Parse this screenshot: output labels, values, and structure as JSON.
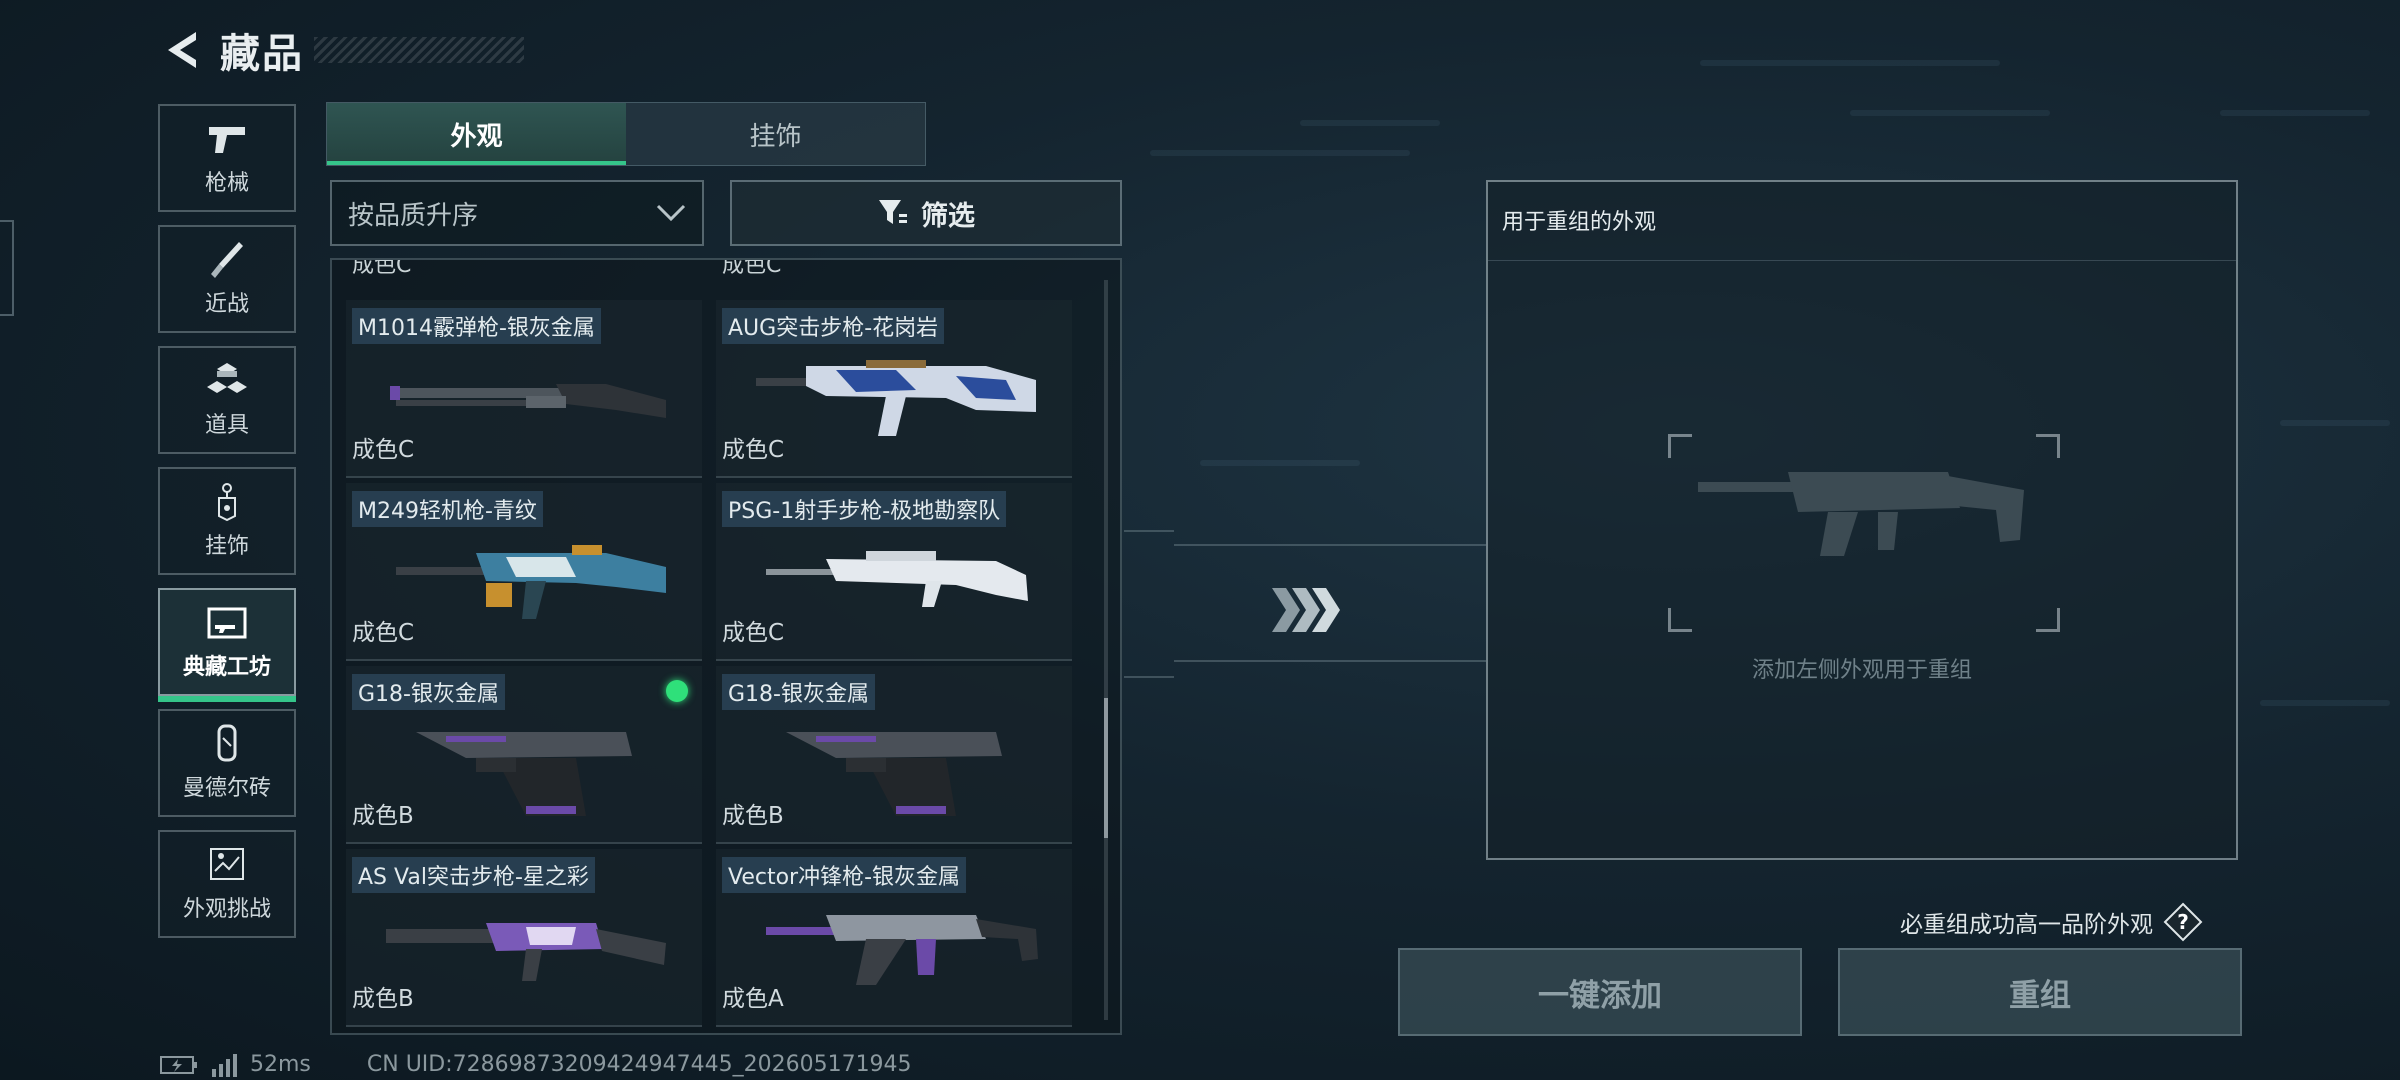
{
  "header": {
    "title": "藏品",
    "back_icon": "back-arrow-icon"
  },
  "sidebar": {
    "items": [
      {
        "label": "枪械",
        "icon": "pistol-icon",
        "active": false
      },
      {
        "label": "近战",
        "icon": "knife-icon",
        "active": false
      },
      {
        "label": "道具",
        "icon": "cubes-icon",
        "active": false
      },
      {
        "label": "挂饰",
        "icon": "pendant-icon",
        "active": false
      },
      {
        "label": "典藏工坊",
        "icon": "workshop-icon",
        "active": true
      },
      {
        "label": "曼德尔砖",
        "icon": "brick-icon",
        "active": false
      },
      {
        "label": "外观挑战",
        "icon": "challenge-icon",
        "active": false
      }
    ]
  },
  "tabs": [
    {
      "label": "外观",
      "active": true
    },
    {
      "label": "挂饰",
      "active": false
    }
  ],
  "sort": {
    "selected": "按品质升序"
  },
  "filter": {
    "label": "筛选",
    "icon": "funnel-icon"
  },
  "grid": {
    "partial_top": [
      "成色C",
      "成色C"
    ],
    "items": [
      {
        "name": "M1014霰弹枪-银灰金属",
        "grade": "成色C",
        "selected": false
      },
      {
        "name": "AUG突击步枪-花岗岩",
        "grade": "成色C",
        "selected": false
      },
      {
        "name": "M249轻机枪-青纹",
        "grade": "成色C",
        "selected": false
      },
      {
        "name": "PSG-1射手步枪-极地勘察队",
        "grade": "成色C",
        "selected": false
      },
      {
        "name": "G18-银灰金属",
        "grade": "成色B",
        "selected": true
      },
      {
        "name": "G18-银灰金属",
        "grade": "成色B",
        "selected": false
      },
      {
        "name": "AS Val突击步枪-星之彩",
        "grade": "成色B",
        "selected": false
      },
      {
        "name": "Vector冲锋枪-银灰金属",
        "grade": "成色A",
        "selected": false
      }
    ]
  },
  "recompose": {
    "title": "用于重组的外观",
    "placeholder": "添加左侧外观用于重组",
    "hint": "必重组成功高一品阶外观",
    "help_icon": "question-icon",
    "add_all_label": "一键添加",
    "recompose_label": "重组"
  },
  "status": {
    "ping": "52ms",
    "uid": "CN UID:7286987320942494744​5_202605171945"
  },
  "colors": {
    "accent": "#35c58a",
    "selected_dot": "#2fe07a"
  }
}
